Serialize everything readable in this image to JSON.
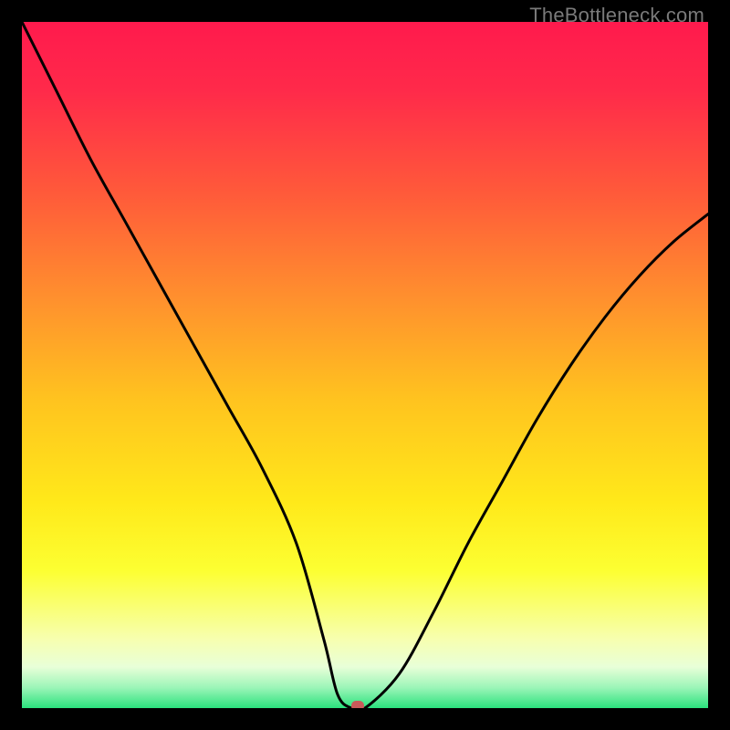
{
  "watermark": "TheBottleneck.com",
  "chart_data": {
    "type": "line",
    "title": "",
    "xlabel": "",
    "ylabel": "",
    "xlim": [
      0,
      100
    ],
    "ylim": [
      0,
      100
    ],
    "series": [
      {
        "name": "bottleneck-curve",
        "x": [
          0,
          5,
          10,
          15,
          20,
          25,
          30,
          35,
          40,
          44,
          46,
          48,
          50,
          55,
          60,
          65,
          70,
          75,
          80,
          85,
          90,
          95,
          100
        ],
        "y": [
          100,
          90,
          80,
          71,
          62,
          53,
          44,
          35,
          24,
          10,
          2,
          0,
          0,
          5,
          14,
          24,
          33,
          42,
          50,
          57,
          63,
          68,
          72
        ]
      }
    ],
    "marker": {
      "x": 49,
      "y": 0,
      "color": "#c85a5a"
    },
    "background_gradient": {
      "top": "#ff1a4d",
      "mid": "#ffe91a",
      "bottom": "#2be27d"
    }
  }
}
